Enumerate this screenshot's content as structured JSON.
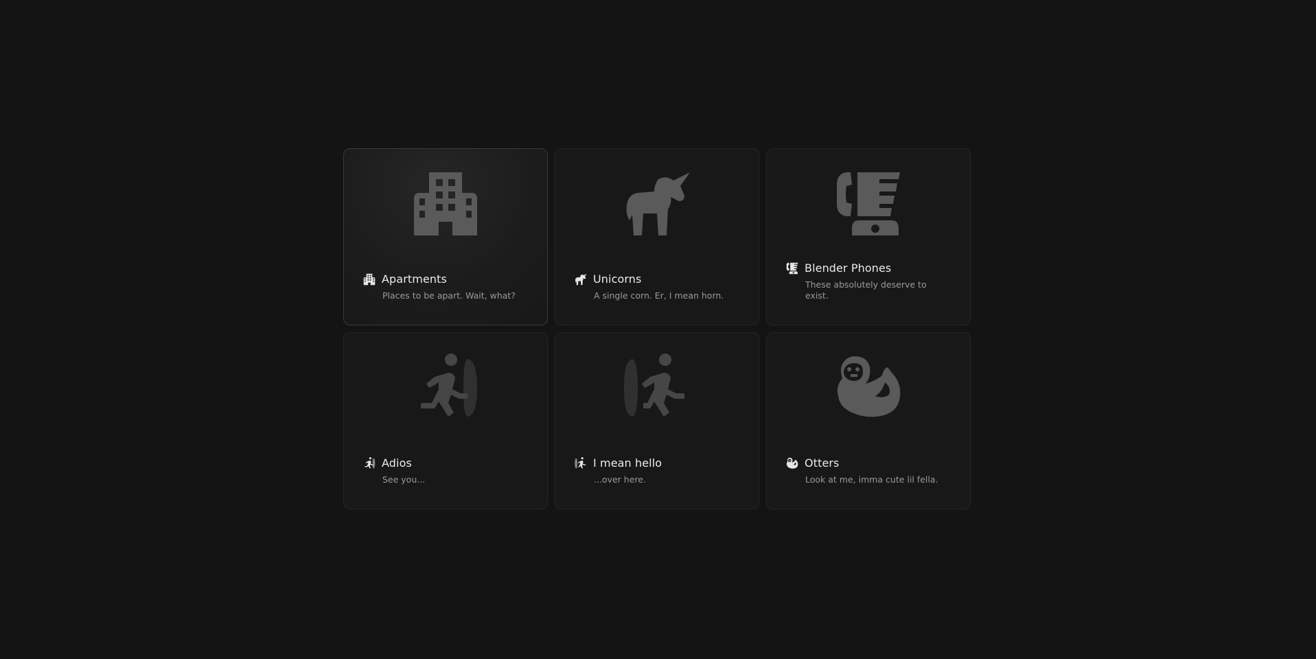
{
  "cards": [
    {
      "icon": "building-icon",
      "title": "Apartments",
      "description": "Places to be apart. Wait, what?"
    },
    {
      "icon": "unicorn-icon",
      "title": "Unicorns",
      "description": "A single corn. Er, I mean horn."
    },
    {
      "icon": "blender-phone-icon",
      "title": "Blender Phones",
      "description": "These absolutely deserve to exist."
    },
    {
      "icon": "door-exit-icon",
      "title": "Adios",
      "description": "See you..."
    },
    {
      "icon": "door-enter-icon",
      "title": "I mean hello",
      "description": "...over here."
    },
    {
      "icon": "otter-icon",
      "title": "Otters",
      "description": "Look at me, imma cute lil fella."
    }
  ],
  "colors": {
    "background": "#141414",
    "card": "#181818",
    "card_border": "#262626",
    "big_icon": "#5a5a5a",
    "small_icon": "#e6e6e6",
    "title": "#ececec",
    "description": "#9a9a9a"
  }
}
